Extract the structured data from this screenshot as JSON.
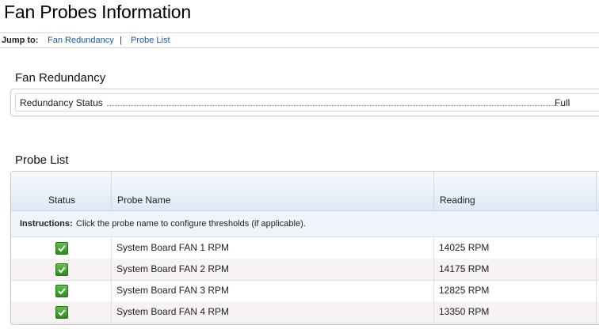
{
  "page": {
    "title": "Fan Probes Information"
  },
  "jump": {
    "label": "Jump to:",
    "links": [
      "Fan Redundancy",
      "Probe List"
    ],
    "separator": "|"
  },
  "redundancy": {
    "title": "Fan Redundancy",
    "status_label": "Redundancy Status",
    "status_value": "Full"
  },
  "probe_list": {
    "title": "Probe List",
    "columns": {
      "status": "Status",
      "name": "Probe Name",
      "reading": "Reading"
    },
    "instructions_label": "Instructions:",
    "instructions_text": "Click the probe name to configure thresholds (if applicable).",
    "rows": [
      {
        "status": "ok",
        "name": "System Board FAN 1 RPM",
        "reading": "14025 RPM"
      },
      {
        "status": "ok",
        "name": "System Board FAN 2 RPM",
        "reading": "14175 RPM"
      },
      {
        "status": "ok",
        "name": "System Board FAN 3 RPM",
        "reading": "12825 RPM"
      },
      {
        "status": "ok",
        "name": "System Board FAN 4 RPM",
        "reading": "13350 RPM"
      }
    ]
  },
  "colors": {
    "link": "#1a5aa8",
    "status_ok": "#3fa32c",
    "header_bg": "#dde9f5",
    "alt_row": "#f7f2f4"
  },
  "icons": {
    "status_ok": "check-icon"
  }
}
